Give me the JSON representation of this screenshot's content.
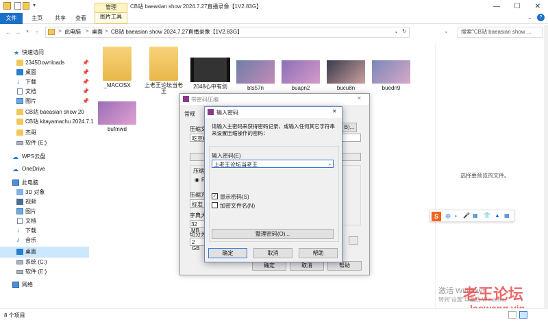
{
  "window": {
    "title": "CB站 baeasian show 2024.7.27直播录像【1V2.83G】",
    "ribbon_context_tab": "管理",
    "minimize": "—",
    "maximize": "☐",
    "close": "✕"
  },
  "ribbon": {
    "tabs": [
      "文件",
      "主页",
      "共享",
      "查看",
      "图片工具"
    ],
    "chevron": "⌄",
    "help": "?"
  },
  "address": {
    "path": [
      "此电脑",
      "桌面",
      "CB站 baeasian show 2024.7.27直播录像【1V2.83G】"
    ],
    "separator": ">",
    "search_placeholder": "搜索\"CB站 baeasian show ..."
  },
  "nav": {
    "quick_access": "快速访问",
    "items": [
      {
        "label": "2345Downloads",
        "pinned": true,
        "icon": "folder"
      },
      {
        "label": "桌面",
        "pinned": true,
        "icon": "desktop"
      },
      {
        "label": "下载",
        "pinned": true,
        "icon": "download"
      },
      {
        "label": "文档",
        "pinned": true,
        "icon": "document"
      },
      {
        "label": "图片",
        "pinned": true,
        "icon": "picture"
      },
      {
        "label": "CB站 baeasian show 20",
        "pinned": false,
        "icon": "folder"
      },
      {
        "label": "CB站 kitayamachu 2024.7.1",
        "pinned": false,
        "icon": "folder"
      },
      {
        "label": "杰哥",
        "pinned": false,
        "icon": "folder"
      },
      {
        "label": "软件 (E:)",
        "pinned": false,
        "icon": "drive"
      }
    ],
    "wps": "WPS云盘",
    "onedrive": "OneDrive",
    "this_pc": "此电脑",
    "pc_items": [
      {
        "label": "3D 对象",
        "icon": "3d"
      },
      {
        "label": "视频",
        "icon": "video"
      },
      {
        "label": "图片",
        "icon": "picture"
      },
      {
        "label": "文档",
        "icon": "document"
      },
      {
        "label": "下载",
        "icon": "download"
      },
      {
        "label": "音乐",
        "icon": "music"
      },
      {
        "label": "桌面",
        "icon": "desktop",
        "selected": true
      },
      {
        "label": "系统 (C:)",
        "icon": "drive"
      },
      {
        "label": "软件 (E:)",
        "icon": "drive"
      }
    ],
    "network": "网络"
  },
  "files": [
    {
      "name": "_MACOSX",
      "type": "folder"
    },
    {
      "name": "上老王论坛当老王",
      "type": "folder"
    },
    {
      "name": "2048心中有剑",
      "type": "video"
    },
    {
      "name": "bts57n",
      "type": "image"
    },
    {
      "name": "buapn2",
      "type": "image"
    },
    {
      "name": "bucu8n",
      "type": "image"
    },
    {
      "name": "buedn9",
      "type": "image"
    },
    {
      "name": "bufmwd",
      "type": "image"
    }
  ],
  "preview_text": "选择要预览的文件。",
  "status": {
    "count": "8 个项目"
  },
  "back_dialog": {
    "title": "带密码压缩",
    "tab": "常规",
    "labels": [
      "压缩文",
      "吃京桥",
      "压缩",
      "RA",
      "压缩方",
      "标准",
      "字典大",
      "32 MB",
      "切分为",
      "2 GB"
    ],
    "ok": "确定",
    "cancel": "取消",
    "help": "帮助",
    "browse": "B)..."
  },
  "front_dialog": {
    "title": "输入密码",
    "instruction": "请输入主密码来获得密码记录，或输入任何其它字符串来设置压缩操作的密码：",
    "password_label": "输入密码(E)",
    "password_value": "上老王论坛当老王",
    "show_password": "显示密码(S)",
    "show_password_checked": true,
    "encrypt_names": "加密文件名(N)",
    "encrypt_names_checked": false,
    "organize_btn": "整理密码(O)...",
    "ok": "确定",
    "cancel": "取消",
    "help": "帮助",
    "close": "✕"
  },
  "ime": {
    "items": [
      "S",
      "中",
      "•",
      "🎤",
      "▦",
      "👕",
      "▲",
      "▦"
    ]
  },
  "watermark": {
    "activate": "激活 Windows",
    "goto": "转到\"设置\"以激活 Windows。",
    "site_cn": "老王论坛",
    "site_en": "laowang.vip"
  },
  "colors": {
    "accent": "#1a6fc9",
    "folder": "#f3c85a",
    "selection": "#cce8ff",
    "watermark": "#e94f4f"
  }
}
